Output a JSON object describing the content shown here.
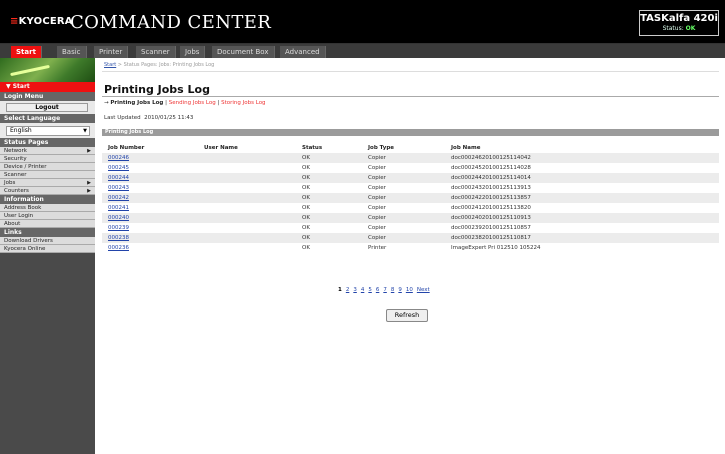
{
  "header": {
    "brand": "KYOCERA",
    "app_title": "COMMAND CENTER",
    "device_model": "TASKalfa 420i",
    "status_label": "Status:",
    "status_value": "OK"
  },
  "tabs": [
    {
      "label": "Start",
      "active": true
    },
    {
      "label": "Basic",
      "active": false
    },
    {
      "label": "Printer",
      "active": false
    },
    {
      "label": "Scanner",
      "active": false
    },
    {
      "label": "Jobs",
      "active": false
    },
    {
      "label": "Document Box",
      "active": false
    },
    {
      "label": "Advanced",
      "active": false
    }
  ],
  "sidebar": {
    "start_label": "▼ Start",
    "login_menu": "Login Menu",
    "logout_label": "Logout",
    "select_language": "Select Language",
    "language_value": "English",
    "status_pages": "Status Pages",
    "status_items": [
      {
        "label": "Network",
        "arrow": true
      },
      {
        "label": "Security",
        "arrow": false
      },
      {
        "label": "Device / Printer",
        "arrow": false
      },
      {
        "label": "Scanner",
        "arrow": false
      },
      {
        "label": "Jobs",
        "arrow": true
      },
      {
        "label": "Counters",
        "arrow": true
      }
    ],
    "information": "Information",
    "info_items": [
      "Address Book",
      "User Login",
      "About"
    ],
    "links": "Links",
    "link_items": [
      "Download Drivers",
      "Kyocera Online"
    ]
  },
  "breadcrumb": {
    "start": "Start",
    "rest": " > Status Pages: Jobs: Printing Jobs Log"
  },
  "page_title": "Printing Jobs Log",
  "subnav": {
    "marker": "→",
    "current": "Printing Jobs Log",
    "sep": " | ",
    "links": [
      "Sending Jobs Log",
      "Storing Jobs Log"
    ]
  },
  "last_updated_label": "Last Updated",
  "last_updated_value": "2010/01/25 11:43",
  "section_title": "Printing Jobs Log",
  "table": {
    "columns": [
      "Job Number",
      "User Name",
      "Status",
      "Job Type",
      "Job Name"
    ],
    "rows": [
      {
        "job": "000246",
        "user": "",
        "status": "OK",
        "type": "Copier",
        "name": "doc00024620100125114042"
      },
      {
        "job": "000245",
        "user": "",
        "status": "OK",
        "type": "Copier",
        "name": "doc00024520100125114028"
      },
      {
        "job": "000244",
        "user": "",
        "status": "OK",
        "type": "Copier",
        "name": "doc00024420100125114014"
      },
      {
        "job": "000243",
        "user": "",
        "status": "OK",
        "type": "Copier",
        "name": "doc00024320100125113913"
      },
      {
        "job": "000242",
        "user": "",
        "status": "OK",
        "type": "Copier",
        "name": "doc00024220100125113857"
      },
      {
        "job": "000241",
        "user": "",
        "status": "OK",
        "type": "Copier",
        "name": "doc00024120100125113820"
      },
      {
        "job": "000240",
        "user": "",
        "status": "OK",
        "type": "Copier",
        "name": "doc00024020100125110913"
      },
      {
        "job": "000239",
        "user": "",
        "status": "OK",
        "type": "Copier",
        "name": "doc00023920100125110857"
      },
      {
        "job": "000238",
        "user": "",
        "status": "OK",
        "type": "Copier",
        "name": "doc00023820100125110817"
      },
      {
        "job": "000236",
        "user": "",
        "status": "OK",
        "type": "Printer",
        "name": "ImageExpert Pri 012510 105224"
      }
    ]
  },
  "pager": {
    "current": "1",
    "pages": [
      "2",
      "3",
      "4",
      "5",
      "6",
      "7",
      "8",
      "9",
      "10"
    ],
    "next": "Next"
  },
  "refresh_label": "Refresh",
  "colors": {
    "accent_red": "#e11111",
    "header_bg": "#000000",
    "sidebar_bg": "#4a4a4a",
    "link_blue": "#2244aa"
  }
}
